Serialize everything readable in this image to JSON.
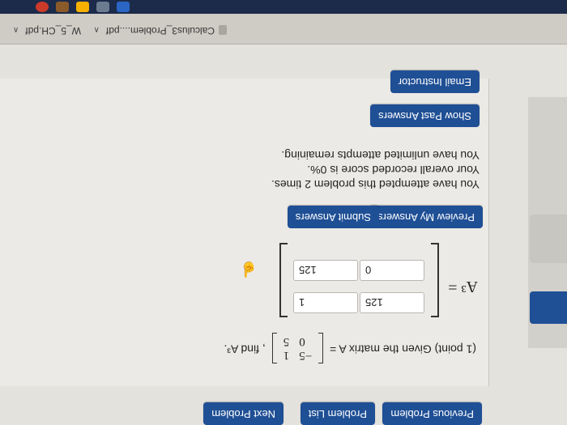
{
  "nav": {
    "previous": "Previous Problem",
    "list": "Problem List",
    "next": "Next Problem"
  },
  "problem": {
    "points": "(1 point) Given the matrix",
    "var": "A =",
    "matrix": [
      [
        "−5",
        "1"
      ],
      [
        "0",
        "5"
      ]
    ],
    "find": ", find A³."
  },
  "answer": {
    "label": "A³ =",
    "cells": [
      "125",
      "1",
      "0",
      "125"
    ]
  },
  "buttons": {
    "preview": "Preview My Answers",
    "submit": "Submit Answers",
    "show_past": "Show Past Answers",
    "email": "Email Instructor"
  },
  "status": {
    "line1": "You have attempted this problem 2 times.",
    "line2": "Your overall recorded score is 0%.",
    "line3": "You have unlimited attempts remaining."
  },
  "downloads": {
    "item1": "Calculus3_Problem....pdf",
    "item2": "W_5_CH.pdf"
  },
  "colors": {
    "button": "#1f4f95"
  }
}
